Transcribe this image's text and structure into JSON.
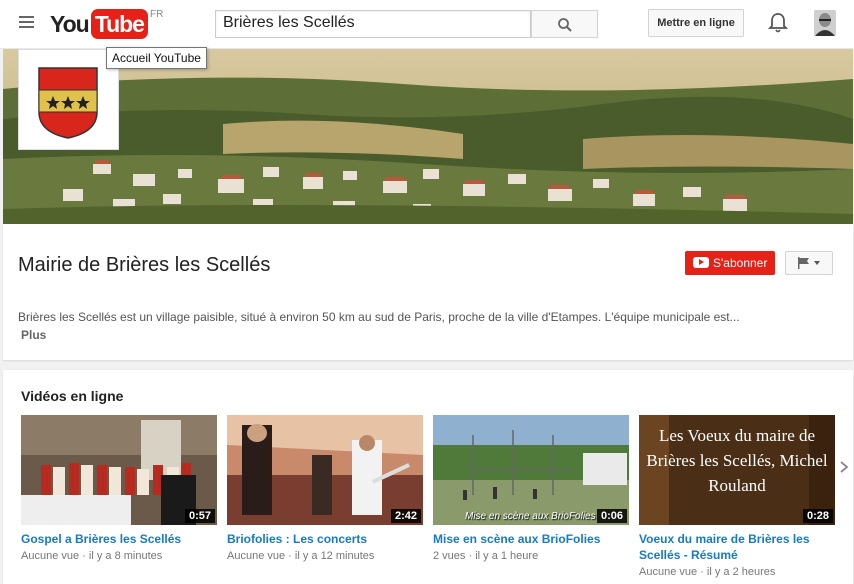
{
  "header": {
    "logo_you": "You",
    "logo_tube": "Tube",
    "logo_country": "FR",
    "search_value": "Brières les Scellés",
    "upload_label": "Mettre en ligne",
    "tooltip": "Accueil YouTube"
  },
  "channel": {
    "title": "Mairie de Brières les Scellés",
    "subscribe_label": "S'abonner",
    "description": "Brières les Scellés est un village paisible, situé à environ 50 km au sud de Paris, proche de la ville d'Etampes. L'équipe municipale est...",
    "more_label": "Plus"
  },
  "section": {
    "title": "Vidéos en ligne"
  },
  "videos": [
    {
      "title": "Gospel a Brières les Scellés",
      "duration": "0:57",
      "views": "Aucune vue",
      "age": "il y a 8 minutes"
    },
    {
      "title": "Briofolies : Les concerts",
      "duration": "2:42",
      "views": "Aucune vue",
      "age": "il y a 12 minutes"
    },
    {
      "title": "Mise en scène aux BrioFolies",
      "duration": "0:06",
      "views": "2 vues",
      "age": "il y a 1 heure",
      "caption": "Mise en scène aux BrioFolies"
    },
    {
      "title": "Voeux du maire de Brières les Scellés - Résumé",
      "duration": "0:28",
      "views": "Aucune vue",
      "age": "il y a 2 heures",
      "overlay_text": "Les Voeux du maire de Brières les Scellés, Michel Rouland"
    }
  ],
  "colors": {
    "brand_red": "#e62117",
    "link_blue": "#167ac6"
  },
  "icons": [
    "menu-icon",
    "search-icon",
    "bell-icon",
    "flag-icon",
    "chevron-right-icon"
  ]
}
